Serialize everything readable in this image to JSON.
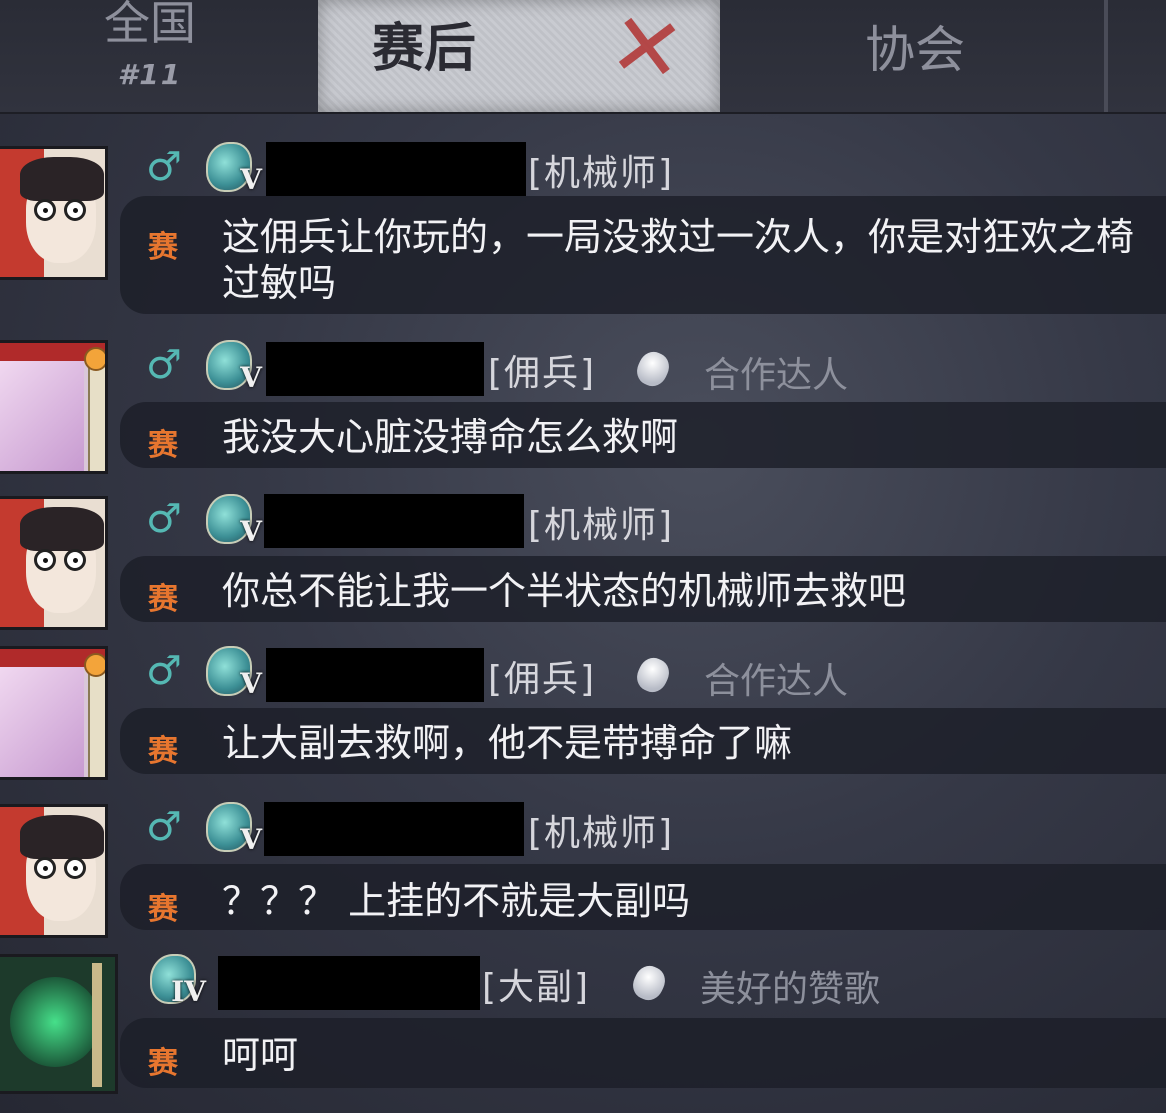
{
  "tabs": {
    "national": {
      "label": "全国",
      "rank": "#11"
    },
    "postmatch": {
      "label": "赛后"
    },
    "guild": {
      "label": "协会"
    }
  },
  "message_tag": "赛",
  "messages": [
    {
      "role": "[机械师]",
      "rank": "V",
      "title": "",
      "text": "这佣兵让你玩的，一局没救过一次人，你是对狂欢之椅过敏吗"
    },
    {
      "role": "[佣兵]",
      "rank": "V",
      "title": "合作达人",
      "text": "我没大心脏没搏命怎么救啊"
    },
    {
      "role": "[机械师]",
      "rank": "V",
      "title": "",
      "text": "你总不能让我一个半状态的机械师去救吧"
    },
    {
      "role": "[佣兵]",
      "rank": "V",
      "title": "合作达人",
      "text": "让大副去救啊，他不是带搏命了嘛"
    },
    {
      "role": "[机械师]",
      "rank": "V",
      "title": "",
      "text": "？？？ 上挂的不就是大副吗"
    },
    {
      "role": "[大副]",
      "rank": "IV",
      "title": "美好的赞歌",
      "text": "呵呵"
    }
  ],
  "colors": {
    "tag": "#e7762f",
    "gender": "#55b8b3",
    "role": "#d6d6dc",
    "title": "#8d909c"
  }
}
